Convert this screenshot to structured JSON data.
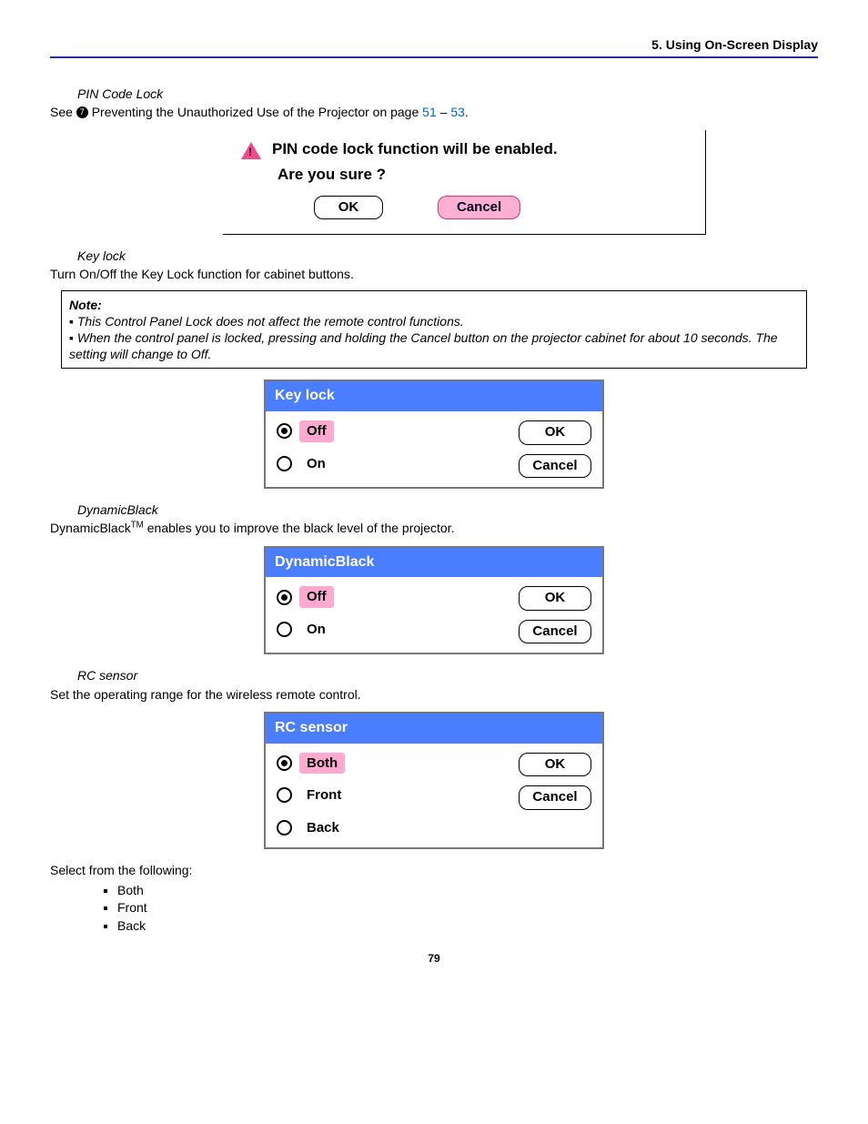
{
  "header": {
    "section": "5. Using On-Screen Display"
  },
  "pin": {
    "subhead": "PIN Code Lock",
    "see_prefix": "See ",
    "see_text": " Preventing the Unauthorized Use of the Projector on page ",
    "link1": "51",
    "dash": " – ",
    "link2": "53",
    "period": ".",
    "dialog_line1": "PIN code lock function will be enabled.",
    "dialog_line2": "Are you sure ?",
    "ok": "OK",
    "cancel": "Cancel"
  },
  "keylock": {
    "subhead": "Key lock",
    "desc": "Turn On/Off the Key Lock function for cabinet buttons.",
    "panel_title": "Key lock",
    "opt_off": "Off",
    "opt_on": "On",
    "ok": "OK",
    "cancel": "Cancel"
  },
  "note": {
    "title": "Note:",
    "line1": "▪ This Control Panel Lock does not affect the remote control functions.",
    "line2": "▪ When the control panel is locked, pressing and holding the Cancel button on the projector cabinet for about 10 seconds. The setting will change to Off."
  },
  "dynamic": {
    "subhead": "DynamicBlack",
    "desc_pre": "DynamicBlack",
    "desc_sup": "TM",
    "desc_post": " enables you to improve the black level of the projector.",
    "panel_title": "DynamicBlack",
    "opt_off": "Off",
    "opt_on": "On",
    "ok": "OK",
    "cancel": "Cancel"
  },
  "rc": {
    "subhead": "RC sensor",
    "desc": "Set the operating range for the wireless remote control.",
    "panel_title": "RC sensor",
    "opt_both": "Both",
    "opt_front": "Front",
    "opt_back": "Back",
    "ok": "OK",
    "cancel": "Cancel",
    "select_label": "Select from the following:",
    "list": {
      "a": "Both",
      "b": "Front",
      "c": "Back"
    }
  },
  "page_number": "79"
}
